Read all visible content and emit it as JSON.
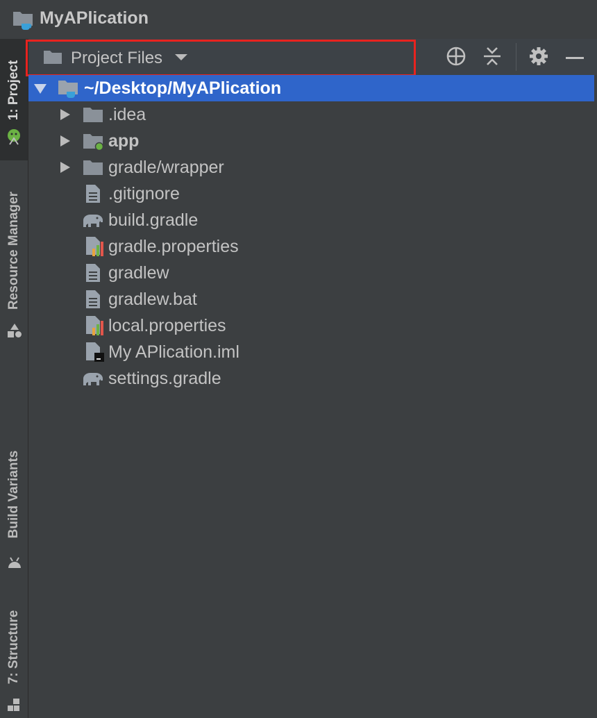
{
  "window": {
    "title": "MyAPlication"
  },
  "tool_windows": {
    "project": "1: Project",
    "resource_manager": "Resource Manager",
    "build_variants": "Build Variants",
    "structure": "7: Structure"
  },
  "panel": {
    "view_selector": "Project Files",
    "buttons": [
      "locate-icon",
      "collapse-all-icon",
      "gear-icon",
      "minimize-icon"
    ]
  },
  "tree": {
    "root": "~/Desktop/MyAPlication",
    "items": [
      {
        "label": ".idea",
        "icon": "folder-icon",
        "expandable": true
      },
      {
        "label": "app",
        "icon": "module-folder-icon",
        "expandable": true
      },
      {
        "label": "gradle/wrapper",
        "icon": "folder-icon",
        "expandable": true
      },
      {
        "label": ".gitignore",
        "icon": "text-file-icon",
        "expandable": false
      },
      {
        "label": "build.gradle",
        "icon": "gradle-elephant-icon",
        "expandable": false
      },
      {
        "label": "gradle.properties",
        "icon": "properties-file-icon",
        "expandable": false
      },
      {
        "label": "gradlew",
        "icon": "text-file-icon",
        "expandable": false
      },
      {
        "label": "gradlew.bat",
        "icon": "text-file-icon",
        "expandable": false
      },
      {
        "label": "local.properties",
        "icon": "properties-file-icon",
        "expandable": false
      },
      {
        "label": "My APlication.iml",
        "icon": "iml-file-icon",
        "expandable": false
      },
      {
        "label": "settings.gradle",
        "icon": "gradle-elephant-icon",
        "expandable": false
      }
    ]
  },
  "colors": {
    "background": "#3c3f41",
    "selection": "#2f65ca",
    "highlight_box": "#e8231f",
    "folder": "#8a9199",
    "android_green": "#6bb244"
  }
}
